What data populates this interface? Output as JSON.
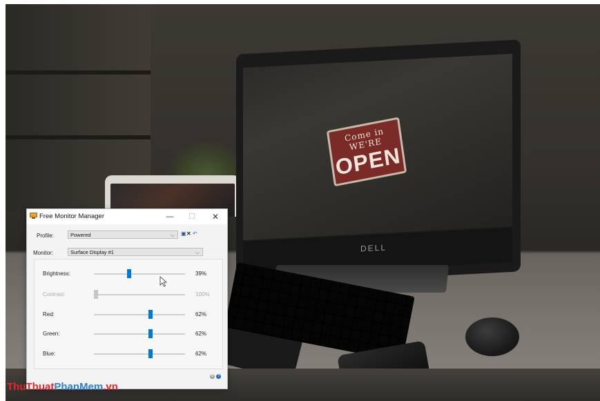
{
  "window": {
    "title": "Free Monitor Manager",
    "minimize_glyph": "—",
    "maximize_glyph": "☐",
    "close_glyph": "✕"
  },
  "profile": {
    "label": "Profile:",
    "value": "Powered",
    "toolbar_icons": [
      "save-icon",
      "delete-icon",
      "undo-icon"
    ]
  },
  "monitor": {
    "label": "Monitor:",
    "value": "Surface Display #1"
  },
  "sliders": [
    {
      "label": "Brightness:",
      "value": 39,
      "value_text": "39%",
      "enabled": true
    },
    {
      "label": "Contrast:",
      "value": 100,
      "value_text": "100%",
      "enabled": false
    },
    {
      "label": "Red:",
      "value": 62,
      "value_text": "62%",
      "enabled": true
    },
    {
      "label": "Green:",
      "value": 62,
      "value_text": "62%",
      "enabled": true
    },
    {
      "label": "Blue:",
      "value": 62,
      "value_text": "62%",
      "enabled": true
    }
  ],
  "footer_icons": [
    "settings-icon",
    "help-icon"
  ],
  "accent_color": "#0078d7",
  "background_photo": {
    "sign_top": "Come in WE'RE",
    "sign_main": "OPEN",
    "monitor_brand": "DELL"
  },
  "watermark": {
    "part1": "ThuThuat",
    "part2": "PhanMem",
    "part3": ".vn"
  }
}
